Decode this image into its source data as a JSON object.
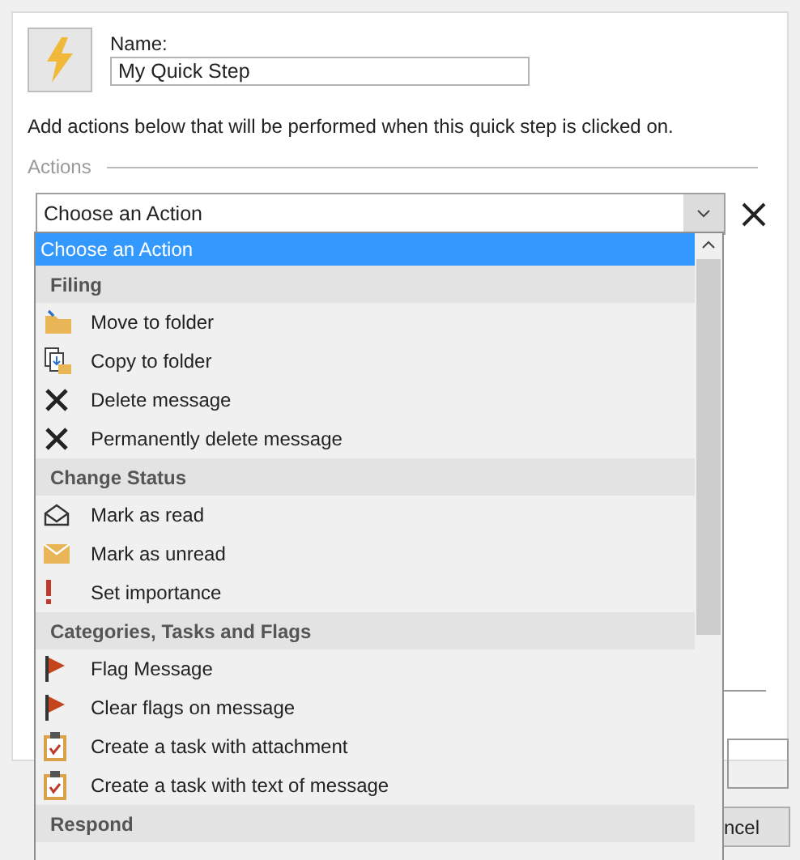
{
  "name_field": {
    "label": "Name:",
    "value": "My Quick Step"
  },
  "instruction": "Add actions below that will be performed when this quick step is clicked on.",
  "actions": {
    "legend": "Actions",
    "combo": {
      "value": "Choose an Action"
    },
    "dropdown": {
      "items": [
        {
          "kind": "option",
          "label": "Choose an Action",
          "selected": true
        },
        {
          "kind": "header",
          "label": "Filing"
        },
        {
          "kind": "option",
          "label": "Move to folder",
          "selected": false
        },
        {
          "kind": "option",
          "label": "Copy to folder",
          "selected": false
        },
        {
          "kind": "option",
          "label": "Delete message",
          "selected": false
        },
        {
          "kind": "option",
          "label": "Permanently delete message",
          "selected": false
        },
        {
          "kind": "header",
          "label": "Change Status"
        },
        {
          "kind": "option",
          "label": "Mark as read",
          "selected": false
        },
        {
          "kind": "option",
          "label": "Mark as unread",
          "selected": false
        },
        {
          "kind": "option",
          "label": "Set importance",
          "selected": false
        },
        {
          "kind": "header",
          "label": "Categories, Tasks and Flags"
        },
        {
          "kind": "option",
          "label": "Flag Message",
          "selected": false
        },
        {
          "kind": "option",
          "label": "Clear flags on message",
          "selected": false
        },
        {
          "kind": "option",
          "label": "Create a task with attachment",
          "selected": false
        },
        {
          "kind": "option",
          "label": "Create a task with text of message",
          "selected": false
        },
        {
          "kind": "header",
          "label": "Respond"
        }
      ]
    }
  },
  "buttons": [
    "ncel"
  ]
}
